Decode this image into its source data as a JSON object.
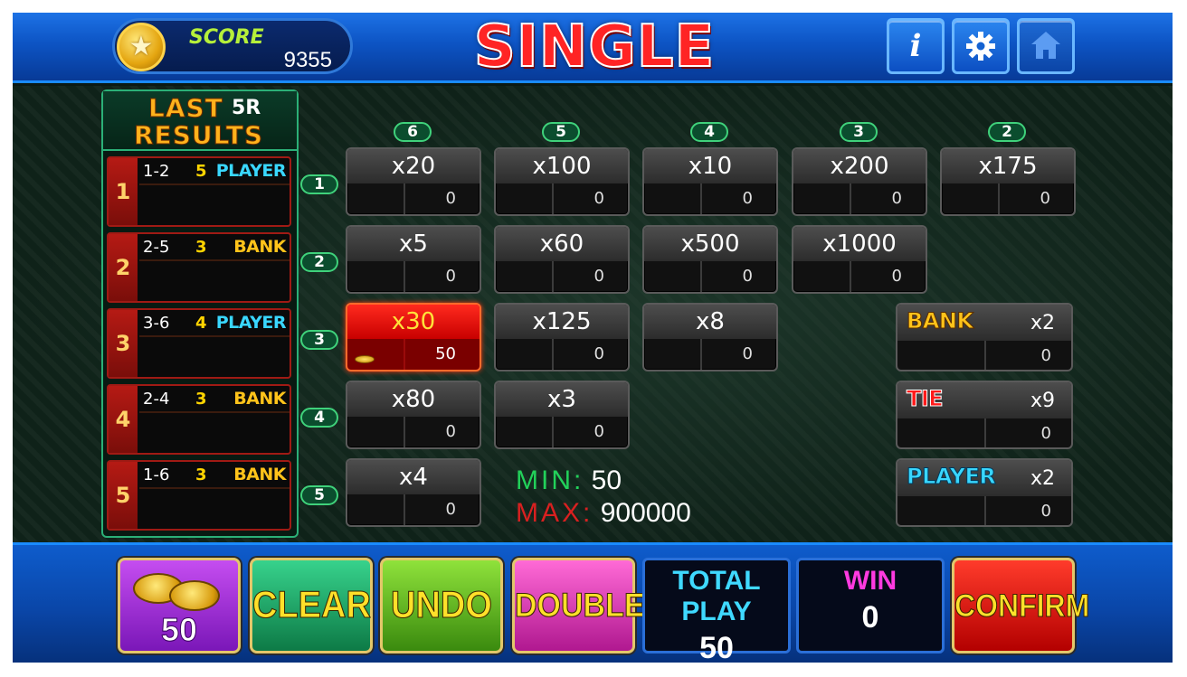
{
  "header": {
    "score_label": "SCORE",
    "score_value": "9355",
    "title": "SINGLE",
    "info_label": "i"
  },
  "last_results": {
    "title_line1": "LAST",
    "rounds": "5R",
    "title_line2": "RESULTS",
    "rows": [
      {
        "index": "1",
        "pair": "1-2",
        "count": "5",
        "winner": "PLAYER"
      },
      {
        "index": "2",
        "pair": "2-5",
        "count": "3",
        "winner": "BANK"
      },
      {
        "index": "3",
        "pair": "3-6",
        "count": "4",
        "winner": "PLAYER"
      },
      {
        "index": "4",
        "pair": "2-4",
        "count": "3",
        "winner": "BANK"
      },
      {
        "index": "5",
        "pair": "1-6",
        "count": "3",
        "winner": "BANK"
      }
    ]
  },
  "board": {
    "columns": [
      "6",
      "5",
      "4",
      "3",
      "2"
    ],
    "rows": [
      "1",
      "2",
      "3",
      "4",
      "5"
    ],
    "cells": [
      {
        "mult": "x20",
        "amount": "0"
      },
      {
        "mult": "x100",
        "amount": "0"
      },
      {
        "mult": "x10",
        "amount": "0"
      },
      {
        "mult": "x200",
        "amount": "0"
      },
      {
        "mult": "x175",
        "amount": "0"
      },
      {
        "mult": "x5",
        "amount": "0"
      },
      {
        "mult": "x60",
        "amount": "0"
      },
      {
        "mult": "x500",
        "amount": "0"
      },
      {
        "mult": "x1000",
        "amount": "0"
      },
      {
        "mult": "x30",
        "amount": "50",
        "selected": true
      },
      {
        "mult": "x125",
        "amount": "0"
      },
      {
        "mult": "x8",
        "amount": "0"
      },
      {
        "mult": "x80",
        "amount": "0"
      },
      {
        "mult": "x3",
        "amount": "0"
      },
      {
        "mult": "x4",
        "amount": "0"
      }
    ],
    "side_bets": [
      {
        "label": "BANK",
        "mult": "x2",
        "amount": "0"
      },
      {
        "label": "TIE",
        "mult": "x9",
        "amount": "0"
      },
      {
        "label": "PLAYER",
        "mult": "x2",
        "amount": "0"
      }
    ],
    "limits": {
      "min_label": "MIN:",
      "min_value": "50",
      "max_label": "MAX:",
      "max_value": "900000"
    }
  },
  "footer": {
    "chip_value": "50",
    "clear": "CLEAR",
    "undo": "UNDO",
    "double": "DOUBLE",
    "total_play_label": "TOTAL PLAY",
    "total_play_value": "50",
    "win_label": "WIN",
    "win_value": "0",
    "confirm": "CONFIRM"
  },
  "colors": {
    "player": "#39d7ff",
    "bank": "#ffc31a",
    "tie": "#ff1a1a",
    "selected_bet": "#d00000"
  }
}
